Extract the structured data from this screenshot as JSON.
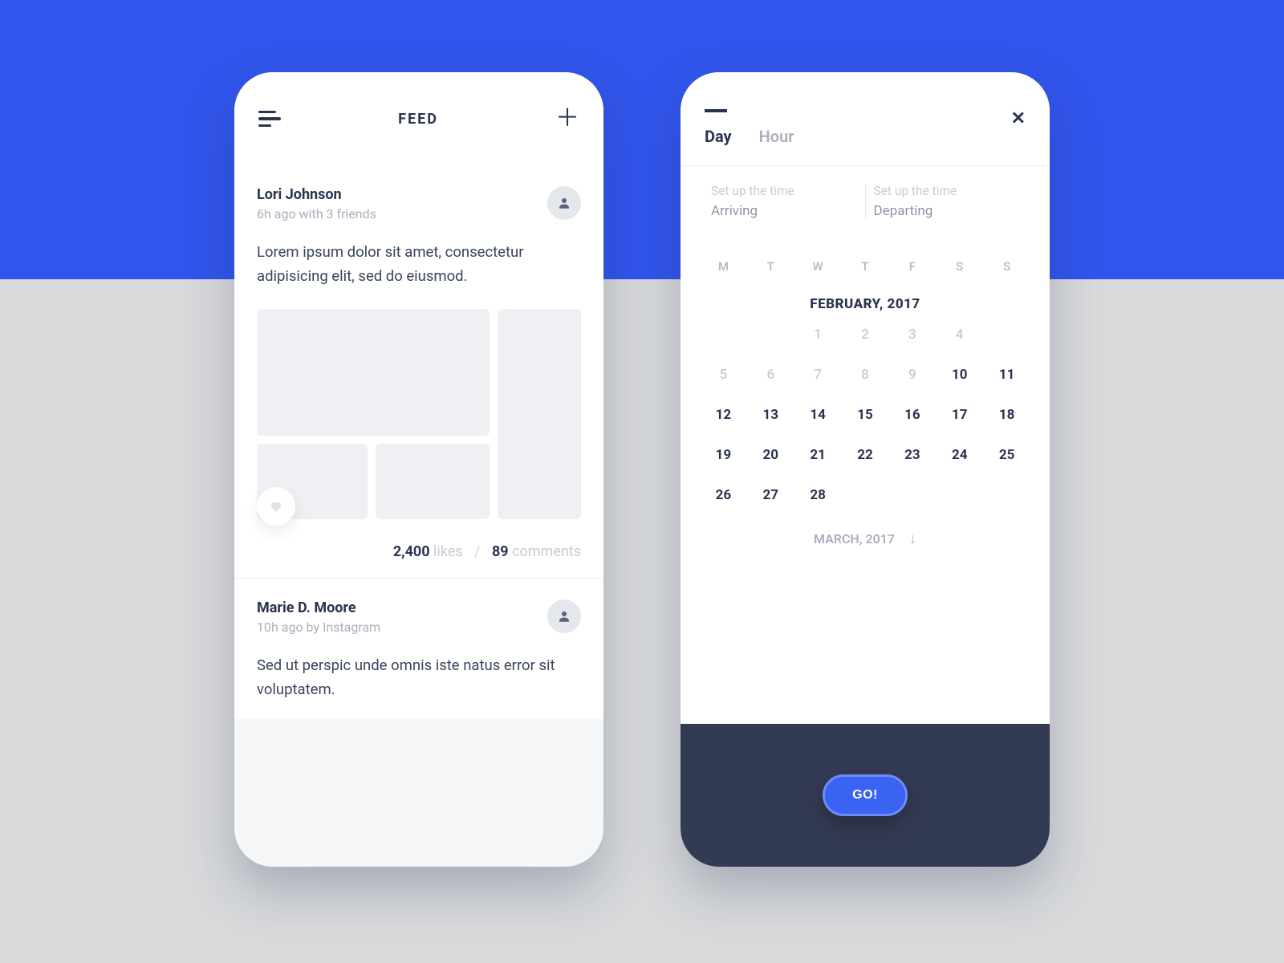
{
  "feed": {
    "title": "FEED",
    "posts": [
      {
        "author": "Lori Johnson",
        "meta": "6h ago with 3 friends",
        "body": "Lorem ipsum dolor sit amet, consectetur adipisicing elit, sed do eiusmod.",
        "likes_count": "2,400",
        "likes_label": "likes",
        "comments_count": "89",
        "comments_label": "comments",
        "separator": "/"
      },
      {
        "author": "Marie D. Moore",
        "meta": "10h ago by Instagram",
        "body": "Sed ut perspic unde omnis iste natus error sit voluptatem."
      }
    ]
  },
  "calendar": {
    "tabs": {
      "day": "Day",
      "hour": "Hour"
    },
    "arriving": {
      "label": "Set up the time",
      "value": "Arriving"
    },
    "departing": {
      "label": "Set up the time",
      "value": "Departing"
    },
    "weekdays": [
      "M",
      "T",
      "W",
      "T",
      "F",
      "S",
      "S"
    ],
    "month_title": "FEBRUARY, 2017",
    "days": [
      {
        "n": "",
        "cls": "empty"
      },
      {
        "n": "",
        "cls": "empty"
      },
      {
        "n": "1",
        "cls": "muted"
      },
      {
        "n": "2",
        "cls": "muted"
      },
      {
        "n": "3",
        "cls": "muted"
      },
      {
        "n": "4",
        "cls": "muted"
      },
      {
        "n": "",
        "cls": "empty"
      },
      {
        "n": "5",
        "cls": "muted"
      },
      {
        "n": "6",
        "cls": "muted"
      },
      {
        "n": "7",
        "cls": "muted"
      },
      {
        "n": "8",
        "cls": "muted"
      },
      {
        "n": "9",
        "cls": "muted"
      },
      {
        "n": "10",
        "cls": ""
      },
      {
        "n": "11",
        "cls": ""
      },
      {
        "n": "12",
        "cls": ""
      },
      {
        "n": "13",
        "cls": ""
      },
      {
        "n": "14",
        "cls": ""
      },
      {
        "n": "15",
        "cls": ""
      },
      {
        "n": "16",
        "cls": ""
      },
      {
        "n": "17",
        "cls": ""
      },
      {
        "n": "18",
        "cls": ""
      },
      {
        "n": "19",
        "cls": ""
      },
      {
        "n": "20",
        "cls": ""
      },
      {
        "n": "21",
        "cls": ""
      },
      {
        "n": "22",
        "cls": ""
      },
      {
        "n": "23",
        "cls": ""
      },
      {
        "n": "24",
        "cls": ""
      },
      {
        "n": "25",
        "cls": ""
      },
      {
        "n": "26",
        "cls": ""
      },
      {
        "n": "27",
        "cls": ""
      },
      {
        "n": "28",
        "cls": ""
      },
      {
        "n": "",
        "cls": "empty"
      },
      {
        "n": "",
        "cls": "empty"
      },
      {
        "n": "",
        "cls": "empty"
      },
      {
        "n": "",
        "cls": "empty"
      }
    ],
    "next_month": "MARCH, 2017",
    "go_label": "GO!"
  }
}
